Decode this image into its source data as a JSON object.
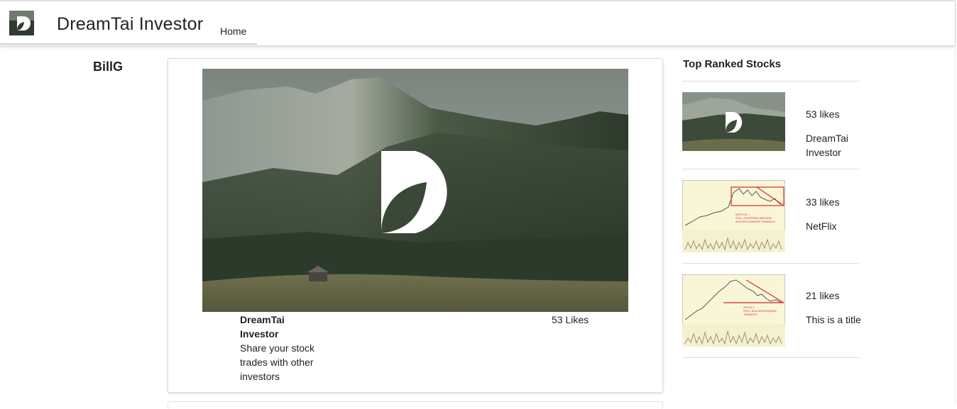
{
  "header": {
    "brand": "DreamTai Investor",
    "nav": {
      "home": "Home"
    }
  },
  "sidebar": {
    "user": "BillG"
  },
  "post": {
    "title": "DreamTai Investor",
    "description": "Share your stock trades with other investors",
    "likes": "53  Likes"
  },
  "ranked": {
    "heading": "Top Ranked Stocks",
    "items": [
      {
        "likes": "53 likes",
        "title": "DreamTai Investor",
        "thumb": "dreamtai-landscape"
      },
      {
        "likes": "33 likes",
        "title": "NetFlix",
        "thumb": "netflix-chart",
        "annotation": "NETFLIX = STILL CHOPPING AROUND IN A DESCENDING TRIANGLE"
      },
      {
        "likes": "21 likes",
        "title": "This is a title",
        "thumb": "apple-chart",
        "annotation": "APPLE = STILL IN A DESCENDING TRIANGLE"
      }
    ]
  },
  "colors": {
    "chart_bg": "#f9f6d8",
    "chart_line": "#d42b2b",
    "forest": "#3c4a3a",
    "sky": "#8d998f"
  }
}
